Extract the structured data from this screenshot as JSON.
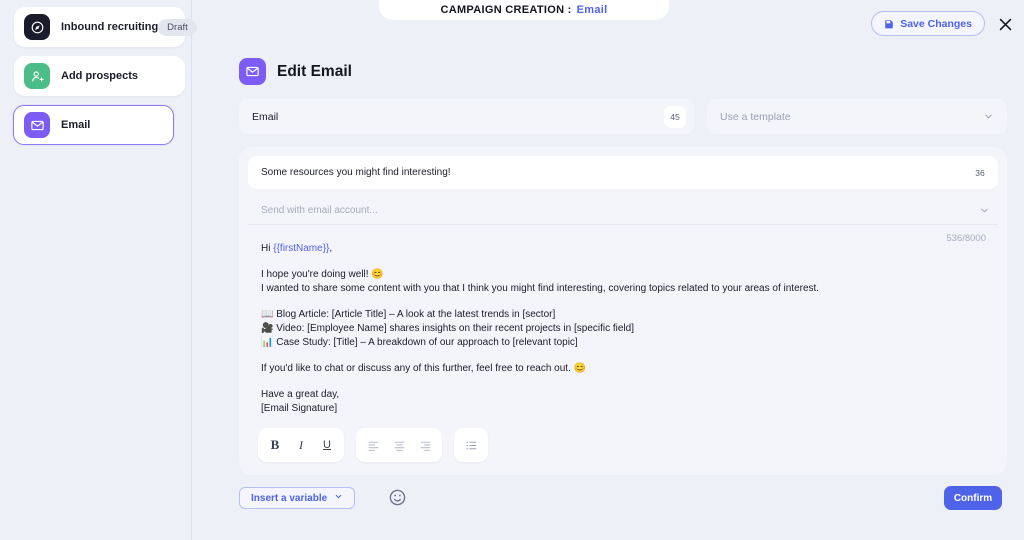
{
  "header": {
    "label": "CAMPAIGN CREATION :",
    "value": "Email",
    "save_label": "Save Changes"
  },
  "sidebar": {
    "items": [
      {
        "label": "Inbound recruiting",
        "badge": "Draft",
        "icon": "rocket-icon"
      },
      {
        "label": "Add prospects",
        "badge": "",
        "icon": "add-person-icon"
      },
      {
        "label": "Email",
        "badge": "",
        "icon": "envelope-icon"
      }
    ]
  },
  "main": {
    "page_title": "Edit Email",
    "email_name": "Email",
    "email_name_count": "45",
    "template_placeholder": "Use a template",
    "subject": "Some resources you might find interesting!",
    "subject_count": "36",
    "account_placeholder": "Send with email account...",
    "char_counter": "536/8000",
    "body": {
      "greeting_prefix": "Hi ",
      "greeting_var": "{{firstName}}",
      "greeting_suffix": ",",
      "line1": "I hope you're doing well! 😊",
      "line2": "I wanted to share some content with you that I think you might find interesting, covering topics related to your areas of interest.",
      "bullet1": "📖 Blog Article: [Article Title] – A look at the latest trends in [sector]",
      "bullet2": "🎥 Video: [Employee Name] shares insights on their recent projects in [specific field]",
      "bullet3": "📊 Case Study: [Title] – A breakdown of our approach to [relevant topic]",
      "closing": "If you'd like to chat or discuss any of this further, feel free to reach out. 😊",
      "signoff1": "Have a great day,",
      "signoff2": "[Email Signature]"
    },
    "toolbar": {
      "bold": "B",
      "italic": "I",
      "underline": "U"
    },
    "insert_variable_label": "Insert a variable",
    "confirm_label": "Confirm"
  },
  "colors": {
    "accent": "#4f63e8",
    "purple": "#7c5cf5",
    "green": "#4dbd88",
    "background": "#eef0f8"
  }
}
